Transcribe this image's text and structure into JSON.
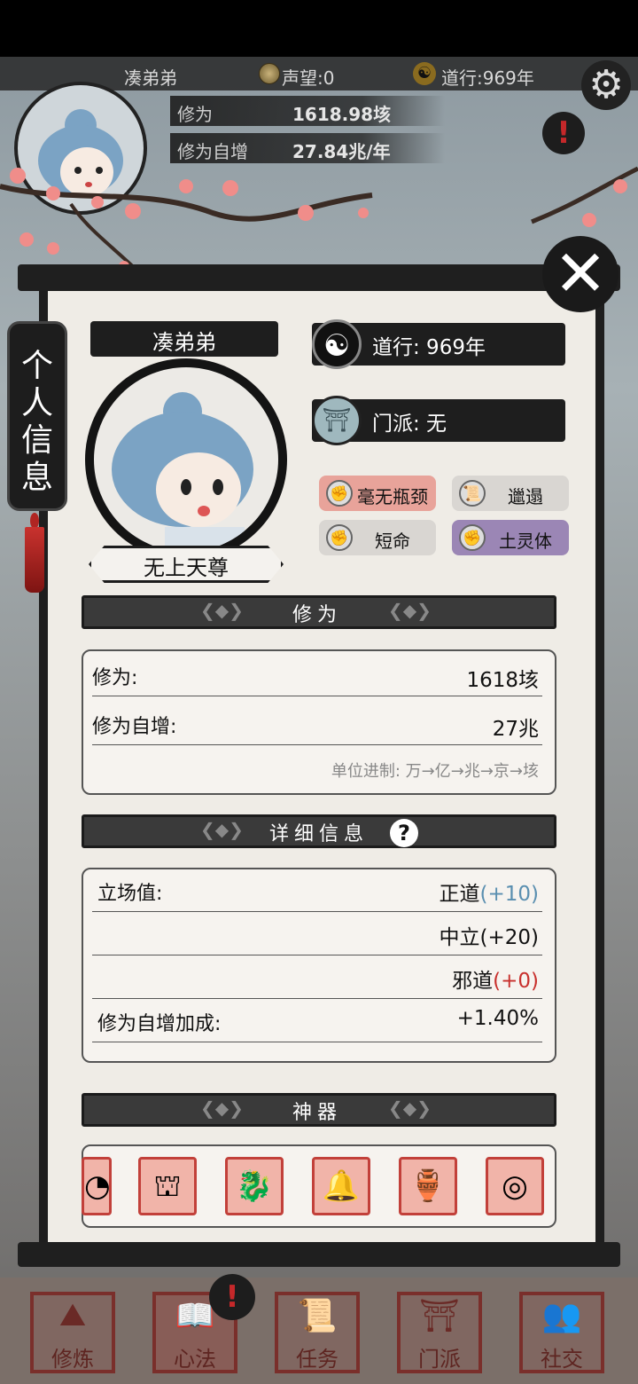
{
  "topbar": {
    "player_name": "凑弟弟",
    "reputation": "声望:0",
    "daoxing": "道行:969年"
  },
  "top_stats": [
    {
      "label": "修为",
      "value": "1618.98垓"
    },
    {
      "label": "修为自增",
      "value": "27.84兆/年"
    }
  ],
  "side_tab": {
    "label": "个人信息"
  },
  "profile": {
    "name": "凑弟弟",
    "title": "无上天尊",
    "daoxing": "道行: 969年",
    "sect": "门派: 无"
  },
  "traits": [
    {
      "label": "毫无瓶颈",
      "color": "#e8a39a"
    },
    {
      "label": "邋遢",
      "color": "#d9d6d2"
    },
    {
      "label": "短命",
      "color": "#d9d6d2"
    },
    {
      "label": "土灵体",
      "color": "#9b86b5"
    }
  ],
  "cultivation_section": {
    "title": "修为",
    "rows": [
      {
        "label": "修为:",
        "value": "1618垓"
      },
      {
        "label": "修为自增:",
        "value": "27兆"
      }
    ],
    "unit_hint": "单位进制: 万→亿→兆→京→垓"
  },
  "details_section": {
    "title": "详细信息",
    "stance_label": "立场值:",
    "stances": [
      {
        "name": "正道",
        "bonus": "(+10)"
      },
      {
        "name": "中立",
        "bonus": "(+20)"
      },
      {
        "name": "邪道",
        "bonus": "(+0)"
      }
    ],
    "bonus_label": "修为自增加成:",
    "bonus_value": "+1.40%"
  },
  "artifacts_section": {
    "title": "神器",
    "items": [
      "ring-artifact",
      "seal-artifact",
      "dragon-artifact",
      "bell-artifact",
      "vase-artifact",
      "mirror-artifact"
    ]
  },
  "bottom_nav": [
    {
      "label": "修炼"
    },
    {
      "label": "心法"
    },
    {
      "label": "任务"
    },
    {
      "label": "门派"
    },
    {
      "label": "社交"
    }
  ],
  "colors": {
    "positive": "#5a8fb0",
    "negative": "#c8302d",
    "panel": "#efece6",
    "ink": "#1e1e1e"
  }
}
